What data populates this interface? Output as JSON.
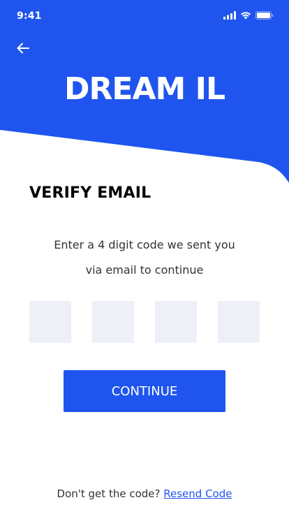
{
  "status_bar": {
    "time": "9:41"
  },
  "header": {
    "app_title": "DREAM IL",
    "back_label": "Back"
  },
  "verify": {
    "title": "VERIFY EMAIL",
    "instructions_line1": "Enter a 4 digit code we sent you",
    "instructions_line2": "via email to continue",
    "code_digits": [
      "",
      "",
      "",
      ""
    ]
  },
  "actions": {
    "continue_label": "CONTINUE"
  },
  "footer": {
    "prompt": "Don't get the code?",
    "resend_label": "Resend Code"
  },
  "colors": {
    "primary": "#1f55ee",
    "code_box_bg": "#edf0f6",
    "text": "#333333"
  },
  "icons": {
    "back": "arrow-left-icon",
    "signal": "signal-icon",
    "wifi": "wifi-icon",
    "battery": "battery-icon"
  }
}
